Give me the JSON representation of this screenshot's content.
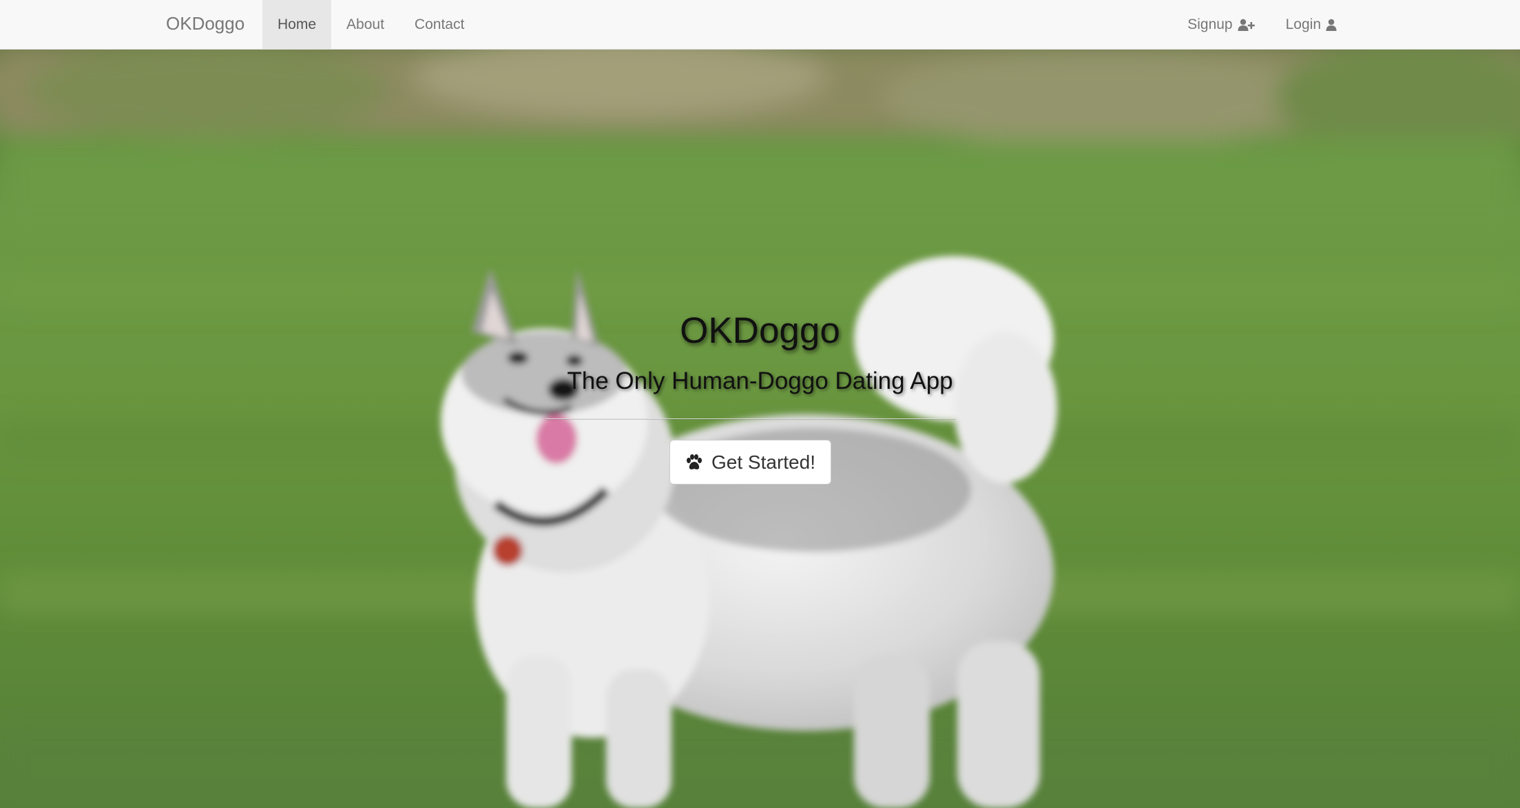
{
  "navbar": {
    "brand": "OKDoggo",
    "left_items": [
      {
        "label": "Home",
        "active": true
      },
      {
        "label": "About",
        "active": false
      },
      {
        "label": "Contact",
        "active": false
      }
    ],
    "right_items": [
      {
        "label": "Signup",
        "icon": "user-plus-icon"
      },
      {
        "label": "Login",
        "icon": "user-icon"
      }
    ]
  },
  "hero": {
    "title": "OKDoggo",
    "subtitle": "The Only Human-Doggo Dating App",
    "cta_label": "Get Started!",
    "cta_icon": "paw-icon",
    "background": "photo of a husky dog standing on a grass field"
  },
  "colors": {
    "navbar_bg": "#f8f8f8",
    "nav_text": "#777777",
    "nav_active_bg": "#e7e7e7",
    "grass": "#6a9640",
    "button_bg": "#ffffff"
  }
}
